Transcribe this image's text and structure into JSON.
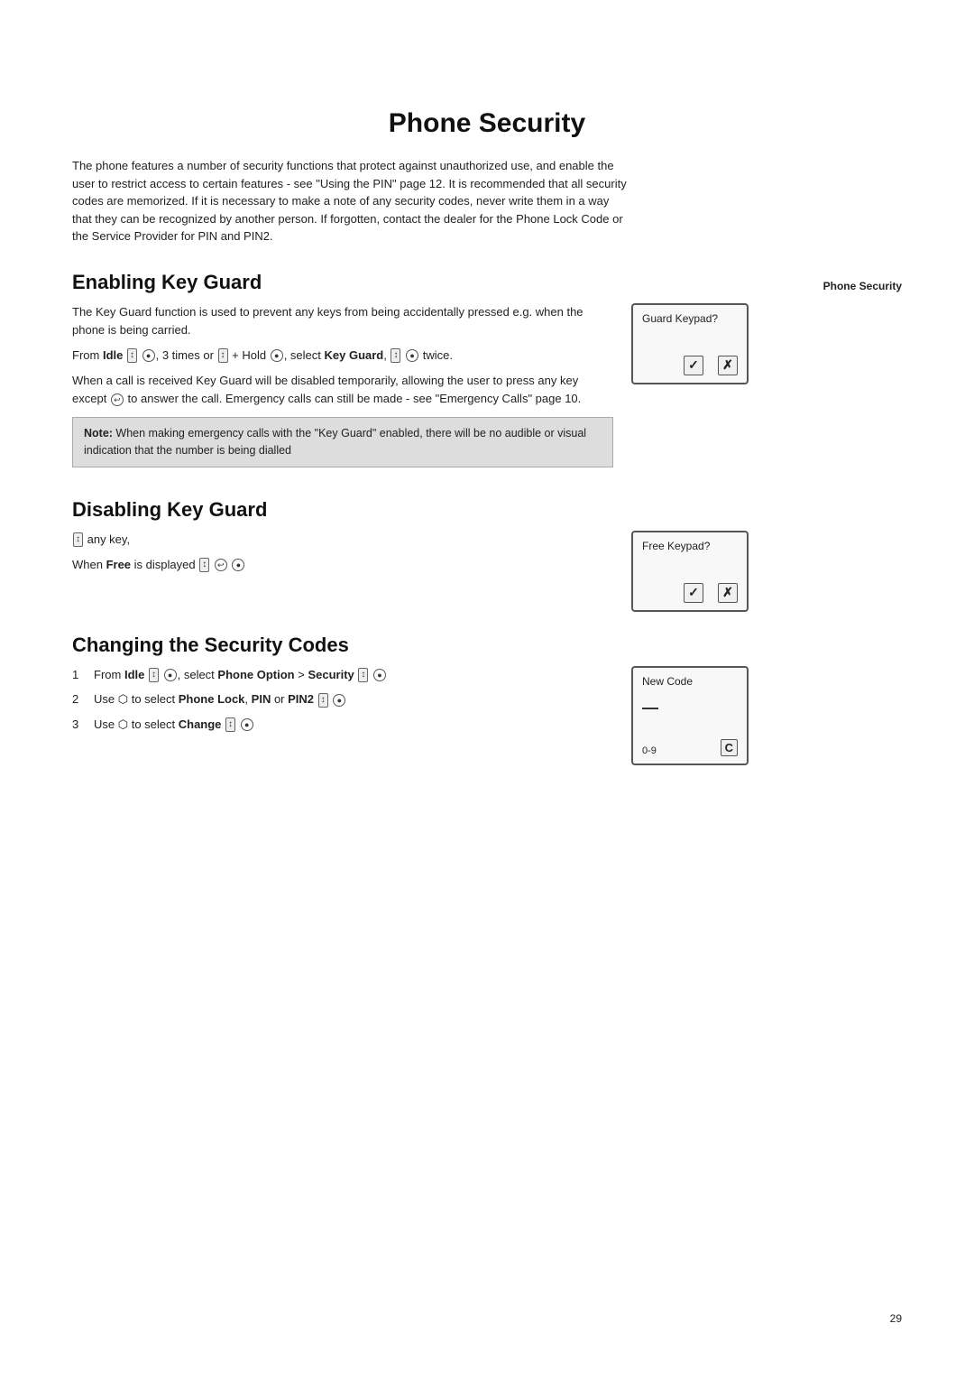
{
  "header": {
    "label": "Phone Security"
  },
  "page_title": "Phone Security",
  "intro": {
    "text": "The phone features a number of security functions that protect against unauthorized use, and enable the user to restrict access to certain features - see \"Using the PIN\" page 12. It is recommended that all security codes are memorized. If it is necessary to make a note of any security codes, never write them in a way that they can be recognized by another person. If forgotten, contact the dealer for the Phone Lock Code or the Service Provider for PIN and PIN2."
  },
  "sections": [
    {
      "id": "enabling-key-guard",
      "title": "Enabling Key Guard",
      "paragraphs": [
        "The Key Guard function is used to prevent any keys from being accidentally pressed e.g. when the phone is being carried.",
        "From Idle [nav] [ok], 3 times or [nav] + Hold [ok], select Key Guard, [nav] [ok] twice.",
        "When a call is received Key Guard will be disabled temporarily, allowing the user to press any key except [end] to answer the call. Emergency calls can still be made - see \"Emergency Calls\" page 10."
      ],
      "note": "Note: When making emergency calls with the \"Key Guard\" enabled, there will be no audible or visual indication that the number is being dialled",
      "screen": {
        "title": "Guard Keypad?",
        "has_check_cross": true
      }
    },
    {
      "id": "disabling-key-guard",
      "title": "Disabling Key Guard",
      "paragraphs": [
        "[nav] any key,",
        "When Free is displayed [nav] [end] [ok]"
      ],
      "screen": {
        "title": "Free Keypad?",
        "has_check_cross": true
      }
    },
    {
      "id": "changing-security-codes",
      "title": "Changing the Security Codes",
      "steps": [
        {
          "num": "1",
          "text": "From Idle [nav] [ok], select Phone Option > Security [nav] [ok]"
        },
        {
          "num": "2",
          "text": "Use [scroll] to select Phone Lock, PIN or PIN2 [nav] [ok]"
        },
        {
          "num": "3",
          "text": "Use [scroll] to select Change [nav] [ok]"
        }
      ],
      "screen": {
        "title": "New Code",
        "has_input": true,
        "bottom_left": "0-9",
        "bottom_right": "C"
      }
    }
  ],
  "page_number": "29"
}
